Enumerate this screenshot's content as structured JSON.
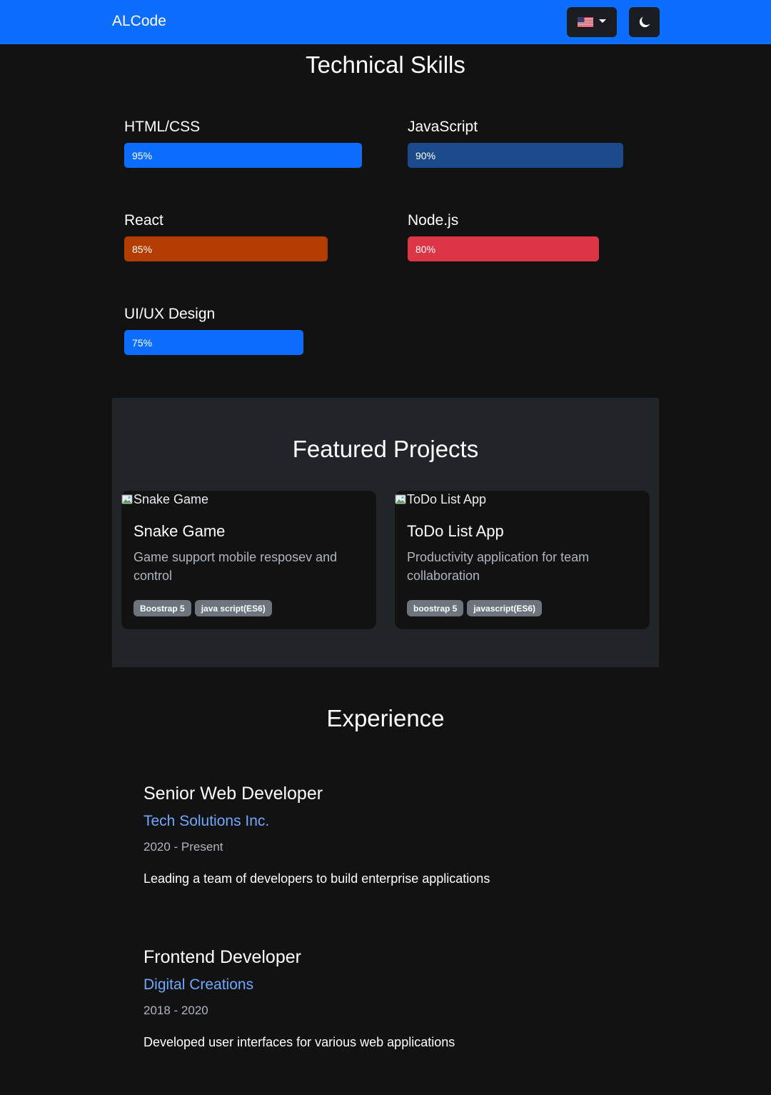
{
  "navbar": {
    "brand": "ALCode",
    "language_icon": "us-flag-icon",
    "theme_icon": "moon-icon"
  },
  "skills": {
    "title": "Technical Skills",
    "items": [
      {
        "name": "HTML/CSS",
        "percent": 95,
        "label": "95%",
        "color": "#0d6efd"
      },
      {
        "name": "JavaScript",
        "percent": 90,
        "label": "90%",
        "color": "#1b4a8c"
      },
      {
        "name": "React",
        "percent": 85,
        "label": "85%",
        "color": "#b33c00"
      },
      {
        "name": "Node.js",
        "percent": 80,
        "label": "80%",
        "color": "#dc3545"
      },
      {
        "name": "UI/UX Design",
        "percent": 75,
        "label": "75%",
        "color": "#0d6efd"
      }
    ]
  },
  "projects": {
    "title": "Featured Projects",
    "items": [
      {
        "image_alt": "Snake Game",
        "title": "Snake Game",
        "description": "Game support mobile resposev and control",
        "tags": [
          "Boostrap 5",
          "java script(ES6)"
        ]
      },
      {
        "image_alt": "ToDo List App",
        "title": "ToDo List App",
        "description": "Productivity application for team collaboration",
        "tags": [
          "boostrap 5",
          "javascript(ES6)"
        ]
      }
    ]
  },
  "experience": {
    "title": "Experience",
    "items": [
      {
        "role": "Senior Web Developer",
        "company": "Tech Solutions Inc.",
        "dates": "2020 - Present",
        "description": "Leading a team of developers to build enterprise applications"
      },
      {
        "role": "Frontend Developer",
        "company": "Digital Creations",
        "dates": "2018 - 2020",
        "description": "Developed user interfaces for various web applications"
      }
    ]
  },
  "colors": {
    "navbar": "#0d6efd",
    "page_background": "#121212",
    "projects_background": "#212529",
    "link": "#6ea8fe"
  }
}
